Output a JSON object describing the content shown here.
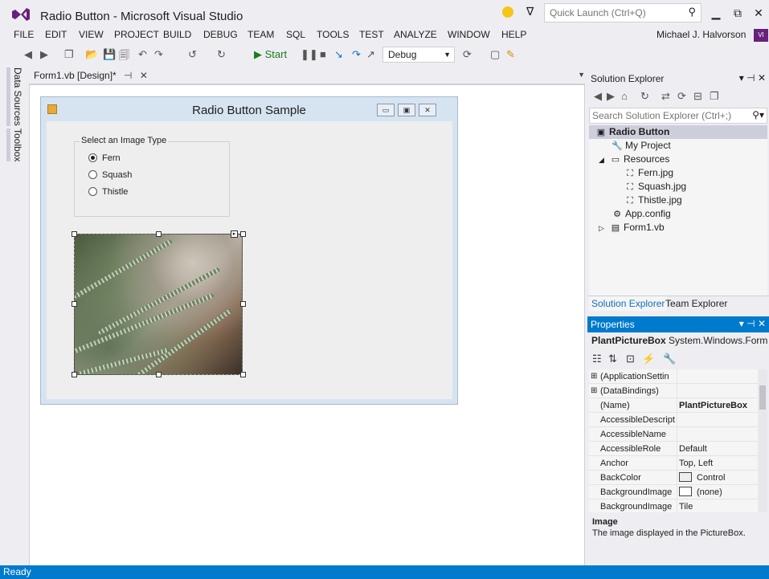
{
  "window": {
    "title": "Radio Button - Microsoft Visual Studio",
    "quick_launch_placeholder": "Quick Launch (Ctrl+Q)",
    "user_name": "Michael J. Halvorson",
    "user_avatar": "VI"
  },
  "menu": [
    "FILE",
    "EDIT",
    "VIEW",
    "PROJECT",
    "BUILD",
    "DEBUG",
    "TEAM",
    "SQL",
    "TOOLS",
    "TEST",
    "ANALYZE",
    "WINDOW",
    "HELP"
  ],
  "toolbar": {
    "start_label": "▶ Start",
    "config": "Debug"
  },
  "side_tabs": [
    "Data Sources",
    "Toolbox"
  ],
  "document_tab": {
    "label": "Form1.vb [Design]*",
    "pin": "⊣",
    "close": "✕"
  },
  "form": {
    "title": "Radio Button Sample",
    "groupbox_caption": "Select an Image Type",
    "radios": [
      {
        "label": "Fern",
        "checked": true
      },
      {
        "label": "Squash",
        "checked": false
      },
      {
        "label": "Thistle",
        "checked": false
      }
    ]
  },
  "solution_explorer": {
    "title": "Solution Explorer",
    "search_placeholder": "Search Solution Explorer (Ctrl+;)",
    "tree": [
      {
        "label": "Radio Button",
        "icon": "vb-project-icon",
        "selected": true
      },
      {
        "label": "My Project",
        "icon": "wrench-icon"
      },
      {
        "label": "Resources",
        "icon": "folder-icon"
      },
      {
        "label": "Fern.jpg",
        "icon": "image-file-icon"
      },
      {
        "label": "Squash.jpg",
        "icon": "image-file-icon"
      },
      {
        "label": "Thistle.jpg",
        "icon": "image-file-icon"
      },
      {
        "label": "App.config",
        "icon": "config-file-icon"
      },
      {
        "label": "Form1.vb",
        "icon": "form-file-icon"
      }
    ],
    "tabs": [
      "Solution Explorer",
      "Team Explorer"
    ]
  },
  "properties": {
    "title": "Properties",
    "object_name": "PlantPictureBox",
    "object_type": "System.Windows.Forms",
    "rows": [
      {
        "name": "(ApplicationSettin",
        "value": "",
        "expandable": true
      },
      {
        "name": "(DataBindings)",
        "value": "",
        "expandable": true
      },
      {
        "name": "(Name)",
        "value": "PlantPictureBox",
        "bold": true
      },
      {
        "name": "AccessibleDescript",
        "value": ""
      },
      {
        "name": "AccessibleName",
        "value": ""
      },
      {
        "name": "AccessibleRole",
        "value": "Default"
      },
      {
        "name": "Anchor",
        "value": "Top, Left"
      },
      {
        "name": "BackColor",
        "value": "Control",
        "swatch": true
      },
      {
        "name": "BackgroundImage",
        "value": "(none)",
        "swatch": true
      },
      {
        "name": "BackgroundImage",
        "value": "Tile"
      }
    ],
    "desc_title": "Image",
    "desc_text": "The image displayed in the PictureBox."
  },
  "status": "Ready",
  "colors": {
    "accent": "#007acc",
    "vs_purple": "#68217a"
  }
}
